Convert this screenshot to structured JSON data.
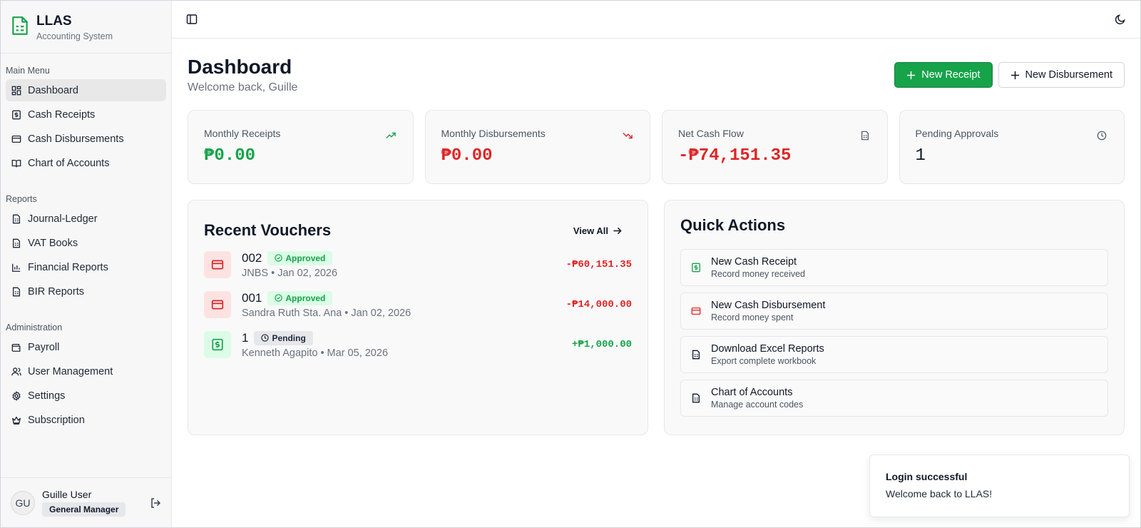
{
  "brand": {
    "title": "LLAS",
    "subtitle": "Accounting System"
  },
  "sidebar": {
    "main_heading": "Main Menu",
    "main_items": [
      {
        "label": "Dashboard",
        "icon": "dashboard-grid-icon"
      },
      {
        "label": "Cash Receipts",
        "icon": "dollar-receipt-icon"
      },
      {
        "label": "Cash Disbursements",
        "icon": "credit-card-icon"
      },
      {
        "label": "Chart of Accounts",
        "icon": "book-open-icon"
      }
    ],
    "reports_heading": "Reports",
    "report_items": [
      {
        "label": "Journal-Ledger",
        "icon": "document-icon"
      },
      {
        "label": "VAT Books",
        "icon": "document-icon"
      },
      {
        "label": "Financial Reports",
        "icon": "bar-chart-icon"
      },
      {
        "label": "BIR Reports",
        "icon": "document-icon"
      }
    ],
    "admin_heading": "Administration",
    "admin_items": [
      {
        "label": "Payroll",
        "icon": "wallet-icon"
      },
      {
        "label": "User Management",
        "icon": "users-icon"
      },
      {
        "label": "Settings",
        "icon": "gear-icon"
      },
      {
        "label": "Subscription",
        "icon": "crown-icon"
      }
    ]
  },
  "user": {
    "initials": "GU",
    "name": "Guille User",
    "role": "General Manager"
  },
  "page": {
    "title": "Dashboard",
    "subtitle": "Welcome back, Guille"
  },
  "actions": {
    "new_receipt": "New Receipt",
    "new_disbursement": "New Disbursement"
  },
  "stats": [
    {
      "label": "Monthly Receipts",
      "value": "₱0.00",
      "color": "#16a34a",
      "icon": "trending-up-icon"
    },
    {
      "label": "Monthly Disbursements",
      "value": "₱0.00",
      "color": "#dc2626",
      "icon": "trending-down-icon"
    },
    {
      "label": "Net Cash Flow",
      "value": "-₱74,151.35",
      "color": "#dc2626",
      "icon": "document-icon"
    },
    {
      "label": "Pending Approvals",
      "value": "1",
      "color": "#111827",
      "icon": "clock-icon"
    }
  ],
  "vouchers": {
    "title": "Recent Vouchers",
    "view_all": "View All",
    "items": [
      {
        "number": "002",
        "status": "Approved",
        "sub": "JNBS • Jan 02, 2026",
        "amount": "-₱60,151.35",
        "type": "disbursement"
      },
      {
        "number": "001",
        "status": "Approved",
        "sub": "Sandra Ruth Sta. Ana • Jan 02, 2026",
        "amount": "-₱14,000.00",
        "type": "disbursement"
      },
      {
        "number": "1",
        "status": "Pending",
        "sub": "Kenneth Agapito • Mar 05, 2026",
        "amount": "+₱1,000.00",
        "type": "receipt"
      }
    ]
  },
  "quick_actions": {
    "title": "Quick Actions",
    "items": [
      {
        "title": "New Cash Receipt",
        "sub": "Record money received",
        "icon": "dollar-receipt-icon"
      },
      {
        "title": "New Cash Disbursement",
        "sub": "Record money spent",
        "icon": "credit-card-icon"
      },
      {
        "title": "Download Excel Reports",
        "sub": "Export complete workbook",
        "icon": "document-icon"
      },
      {
        "title": "Chart of Accounts",
        "sub": "Manage account codes",
        "icon": "document-icon"
      }
    ]
  },
  "toast": {
    "title": "Login successful",
    "message": "Welcome back to LLAS!"
  },
  "colors": {
    "accent": "#16a34a",
    "negative": "#dc2626"
  }
}
